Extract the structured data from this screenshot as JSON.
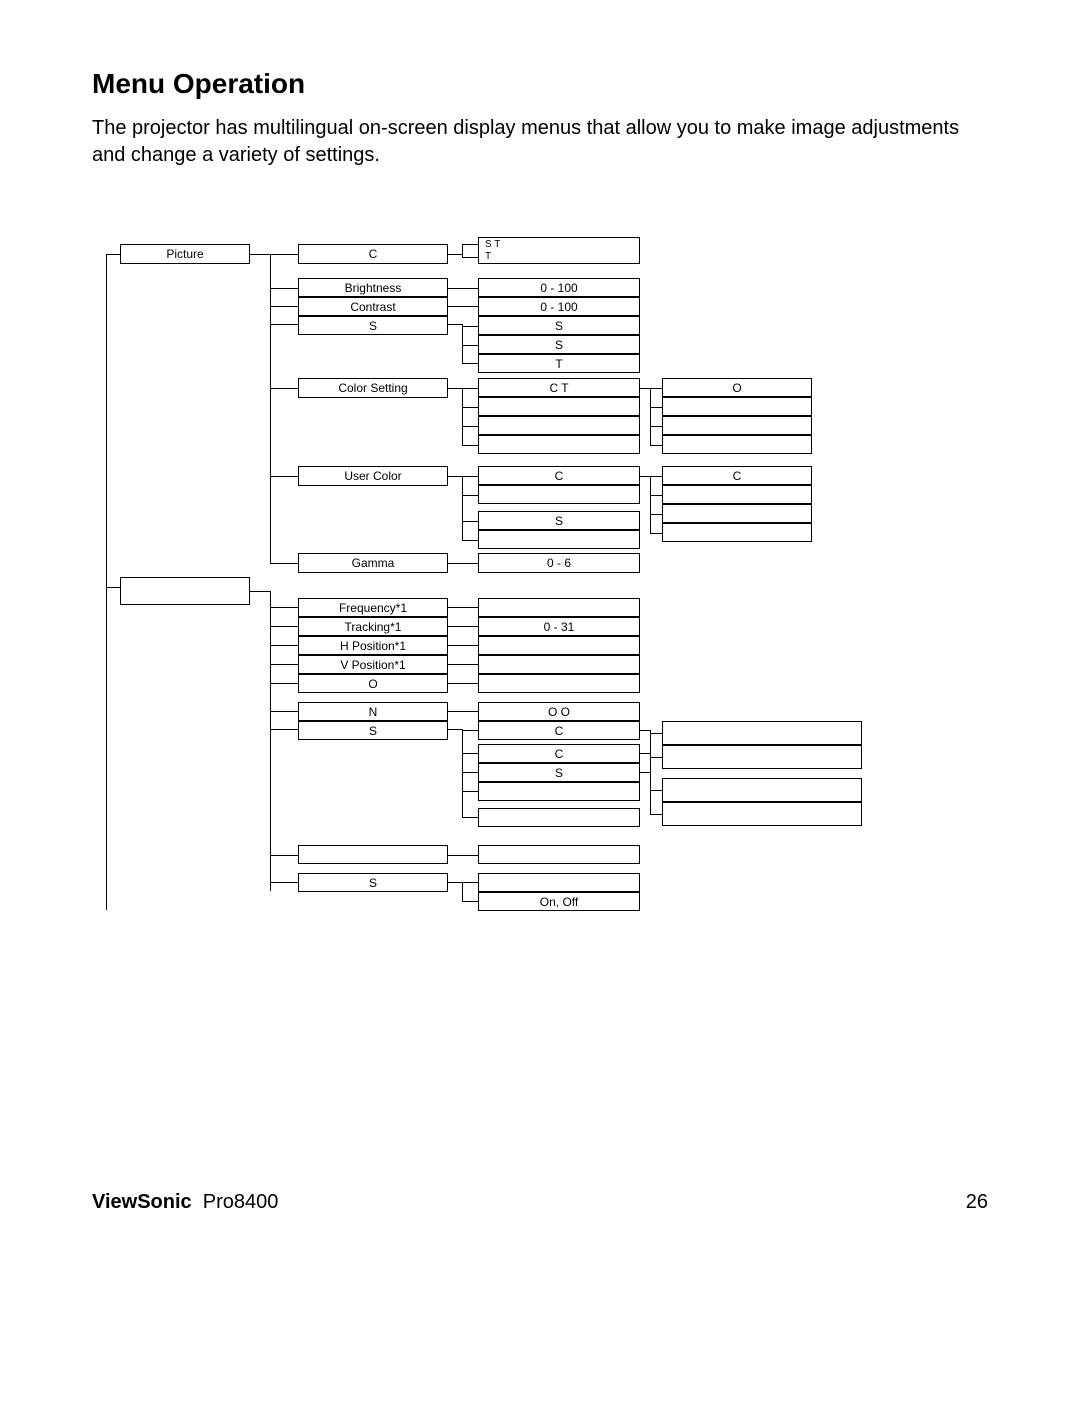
{
  "title": "Menu Operation",
  "body": "The projector has multilingual on-screen display menus that allow you to make image adjustments and change a variety of settings.",
  "footer": {
    "brand_bold": "ViewSonic",
    "brand_rest": "Pro8400",
    "page": "26"
  },
  "c1": {
    "picture": "Picture",
    "blank": ""
  },
  "c2": {
    "c": "C",
    "brightness": "Brightness",
    "contrast": "Contrast",
    "s": "S",
    "color_setting": "Color Setting",
    "user_color": "User Color",
    "gamma": "Gamma",
    "frequency": "Frequency*1",
    "tracking": "Tracking*1",
    "hpos": "H Position*1",
    "vpos": "V Position*1",
    "o": "O",
    "n": "N",
    "s2": "S",
    "s3": "S"
  },
  "c3": {
    "st": "S T",
    "t": "T",
    "r0_100a": "0 - 100",
    "r0_100b": "0 - 100",
    "s1": "S",
    "s2": "S",
    "t2": "T",
    "ct": "C T",
    "c": "C",
    "s3": "S",
    "r0_6": "0 - 6",
    "r0_31": "0 - 31",
    "oo": "O O",
    "c2": "C",
    "c3": "C",
    "s4": "S",
    "onoff": "On, Off"
  },
  "c4": {
    "o": "O",
    "c": "C"
  }
}
